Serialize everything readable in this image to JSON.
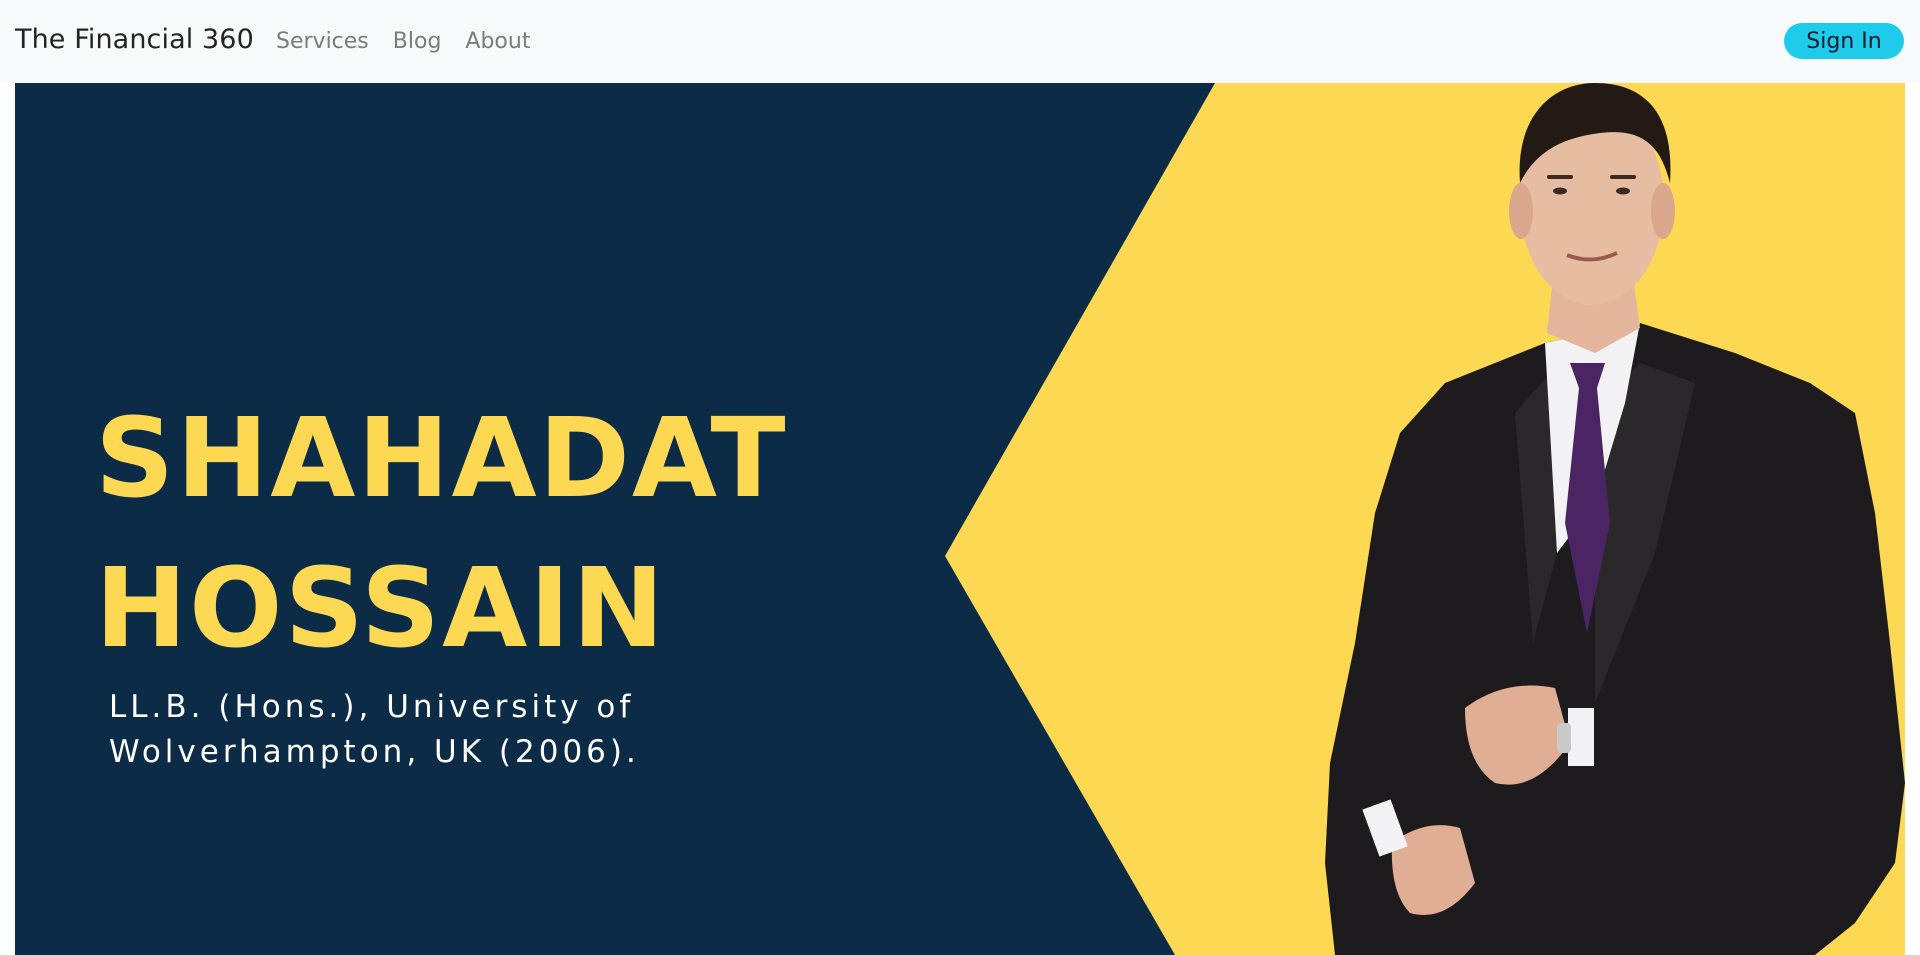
{
  "navbar": {
    "brand": "The Financial 360",
    "links": [
      {
        "label": "Services"
      },
      {
        "label": "Blog"
      },
      {
        "label": "About"
      }
    ],
    "signin_label": "Sign In"
  },
  "hero": {
    "name_line1": "SHAHADAT",
    "name_line2": "HOSSAIN",
    "credential": "LL.B. (Hons.), University of Wolverhampton, UK (2006).",
    "colors": {
      "navy": "#0c2b47",
      "yellow": "#fdd853",
      "accent_button": "#1fcbea"
    }
  }
}
